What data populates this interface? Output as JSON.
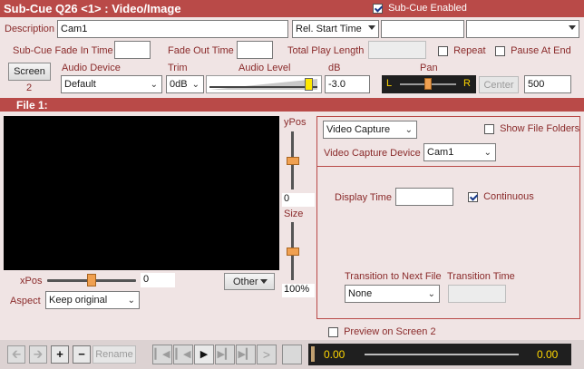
{
  "title": "Sub-Cue Q26 <1> : Video/Image",
  "subcue_enabled": {
    "label": "Sub-Cue Enabled",
    "checked": true
  },
  "description": {
    "label": "Description",
    "value": "Cam1"
  },
  "rel_start": {
    "value": "Rel. Start Time",
    "time": "",
    "extra": ""
  },
  "fade_in": {
    "label": "Sub-Cue Fade In Time",
    "value": ""
  },
  "fade_out": {
    "label": "Fade Out Time",
    "value": ""
  },
  "total_play": {
    "label": "Total Play Length",
    "value": ""
  },
  "repeat": {
    "label": "Repeat",
    "checked": false
  },
  "pause_at_end": {
    "label": "Pause At End",
    "checked": false
  },
  "screen": {
    "button": "Screen",
    "number": "2"
  },
  "audio_device": {
    "label": "Audio Device",
    "value": "Default"
  },
  "trim": {
    "label": "Trim",
    "value": "0dB"
  },
  "audio_level": {
    "label": "Audio Level",
    "db_label": "dB",
    "value": "-3.0",
    "level_fraction": 0.94
  },
  "pan": {
    "label": "Pan",
    "left": "L",
    "right": "R",
    "center_button": "Center",
    "value": "500",
    "position_fraction": 0.5
  },
  "file_section": {
    "label": "File 1:"
  },
  "ypos": {
    "label": "yPos",
    "value": "0"
  },
  "size": {
    "label": "Size",
    "value": "100%"
  },
  "xpos": {
    "label": "xPos",
    "value": "0"
  },
  "aspect": {
    "label": "Aspect",
    "value": "Keep original"
  },
  "other_button": "Other",
  "source": {
    "type": "Video Capture",
    "show_file_folders": {
      "label": "Show File Folders",
      "checked": false
    },
    "device_label": "Video Capture Device",
    "device": "Cam1"
  },
  "display_time": {
    "label": "Display Time",
    "value": ""
  },
  "continuous": {
    "label": "Continuous",
    "checked": true
  },
  "transition": {
    "label": "Transition to Next File",
    "value": "None",
    "time_label": "Transition Time",
    "time_value": ""
  },
  "preview": {
    "label": "Preview on Screen 2",
    "checked": false
  },
  "rename_button": "Rename",
  "position_start": "0.00",
  "position_end": "0.00",
  "colors": {
    "accent": "#b94a48",
    "panel": "#f0e4e4",
    "border": "#b94a48",
    "thumb_yellow": "#ffe800",
    "thumb_orange": "#f0a050"
  }
}
